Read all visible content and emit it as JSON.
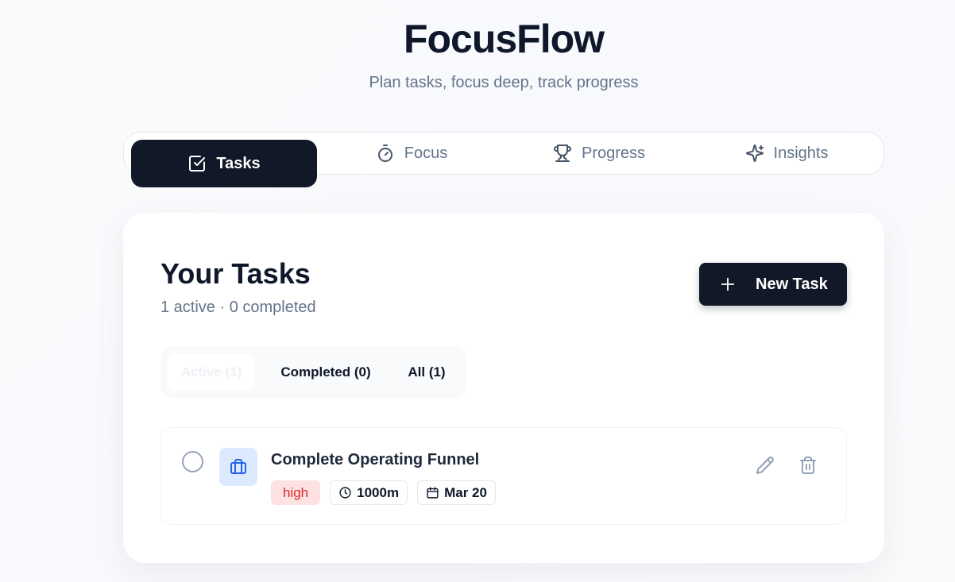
{
  "app": {
    "title": "FocusFlow",
    "subtitle": "Plan tasks, focus deep, track progress"
  },
  "nav": {
    "tabs": [
      {
        "label": "Tasks",
        "icon": "checkbox-icon",
        "active": true
      },
      {
        "label": "Focus",
        "icon": "timer-icon",
        "active": false
      },
      {
        "label": "Progress",
        "icon": "trophy-icon",
        "active": false
      },
      {
        "label": "Insights",
        "icon": "sparkles-icon",
        "active": false
      }
    ]
  },
  "tasks": {
    "title": "Your Tasks",
    "summary": "1 active · 0 completed",
    "new_task_label": "New Task",
    "filters": [
      {
        "label": "Active (1)",
        "active": true
      },
      {
        "label": "Completed (0)",
        "active": false
      },
      {
        "label": "All (1)",
        "active": false
      }
    ],
    "items": [
      {
        "title": "Complete Operating Funnel",
        "category_icon": "briefcase-icon",
        "priority": "high",
        "duration": "1000m",
        "due": "Mar 20"
      }
    ]
  },
  "colors": {
    "primary": "#111827",
    "priority_high_bg": "#fee2e2",
    "priority_high_text": "#dc2626",
    "category_bg": "#dbeafe",
    "category_icon": "#2563eb"
  }
}
